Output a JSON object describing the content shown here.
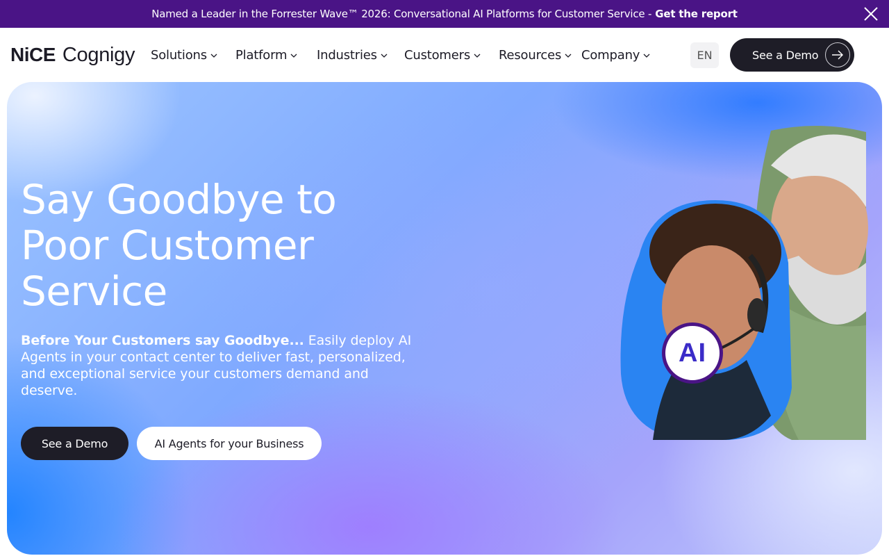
{
  "announcement": {
    "text": "Named a Leader in the Forrester Wave™ 2026: Conversational AI Platforms for Customer Service -",
    "link": "Get the report",
    "close_icon": "close-icon"
  },
  "header": {
    "logo_nice": "NiCE",
    "logo_cognigy": "Cognigy",
    "nav": [
      "Solutions",
      "Platform",
      "Industries",
      "Customers",
      "Resources",
      "Company"
    ],
    "lang": "EN",
    "cta": "See a Demo"
  },
  "hero": {
    "title": "Say Goodbye to Poor Customer Service",
    "subtitle_bold": "Before Your Customers say Goodbye...",
    "subtitle_rest": " Easily deploy AI Agents in your contact center to deliver fast, personalized, and exceptional service your customers demand and deserve.",
    "primary_button": "See a Demo",
    "secondary_button": "AI Agents for your Business",
    "badge": "AI"
  },
  "colors": {
    "announcement_bg": "#4a1486",
    "button_dark": "#1e1d27",
    "badge_ring": "#4a1486",
    "badge_text": "#3b2cc8"
  }
}
